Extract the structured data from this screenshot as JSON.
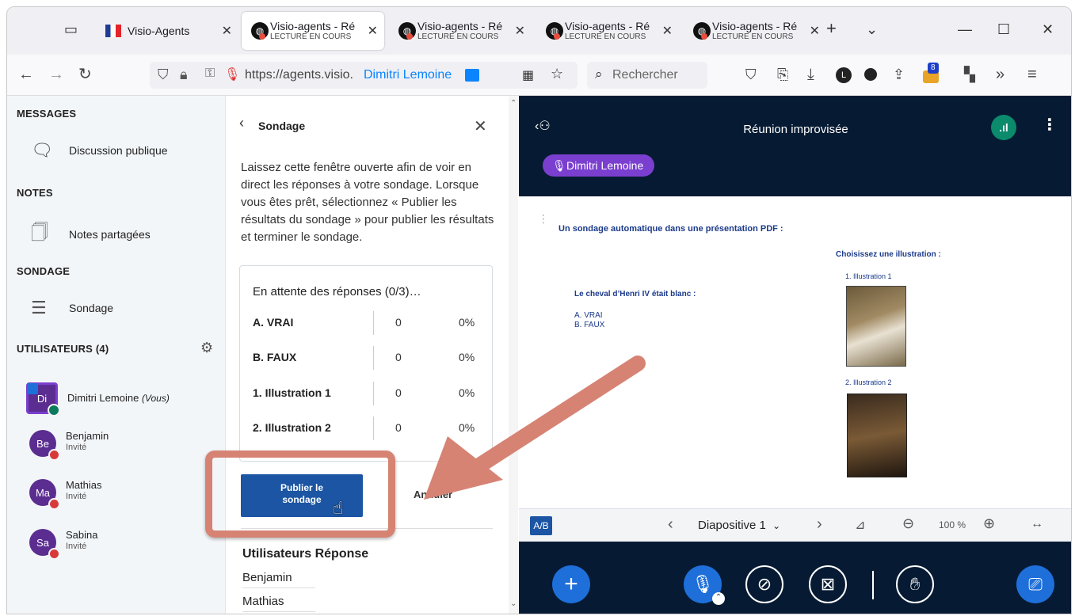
{
  "browser": {
    "tabs": [
      {
        "title": "Visio-Agents",
        "subtitle": ""
      },
      {
        "title": "Visio-agents - Ré",
        "subtitle": "LECTURE EN COURS"
      },
      {
        "title": "Visio-agents - Ré",
        "subtitle": "LECTURE EN COURS"
      },
      {
        "title": "Visio-agents - Ré",
        "subtitle": "LECTURE EN COURS"
      },
      {
        "title": "Visio-agents - Ré",
        "subtitle": "LECTURE EN COURS"
      }
    ],
    "url": "https://agents.visio.",
    "url_user": "Dimitri Lemoine",
    "search_placeholder": "Rechercher",
    "ext_badge": "8"
  },
  "sidebar": {
    "messages_heading": "MESSAGES",
    "public_chat": "Discussion publique",
    "notes_heading": "NOTES",
    "shared_notes": "Notes partagées",
    "poll_heading": "SONDAGE",
    "poll_item": "Sondage",
    "users_heading": "UTILISATEURS (4)",
    "users": [
      {
        "initials": "Di",
        "name": "Dimitri Lemoine",
        "suffix": "(Vous)",
        "role": "",
        "color": "#5b2d90"
      },
      {
        "initials": "Be",
        "name": "Benjamin",
        "suffix": "",
        "role": "Invité",
        "color": "#5b2d90"
      },
      {
        "initials": "Ma",
        "name": "Mathias",
        "suffix": "",
        "role": "Invité",
        "color": "#5b2d90"
      },
      {
        "initials": "Sa",
        "name": "Sabina",
        "suffix": "",
        "role": "Invité",
        "color": "#5b2d90"
      }
    ]
  },
  "poll_panel": {
    "title": "Sondage",
    "description": "Laissez cette fenêtre ouverte afin de voir en direct les réponses à votre sondage. Lorsque vous êtes prêt, sélectionnez « Publier les résultats du sondage » pour publier les résultats et terminer le sondage.",
    "waiting": "En attente des réponses (0/3)…",
    "rows": [
      {
        "label": "A. VRAI",
        "count": "0",
        "percent": "0%"
      },
      {
        "label": "B. FAUX",
        "count": "0",
        "percent": "0%"
      },
      {
        "label": "1. Illustration 1",
        "count": "0",
        "percent": "0%"
      },
      {
        "label": "2. Illustration 2",
        "count": "0",
        "percent": "0%"
      }
    ],
    "publish_label": "Publier le sondage",
    "cancel_label": "Annuler",
    "responses_header_users": "Utilisateurs",
    "responses_header_answer": "Réponse",
    "responders": [
      "Benjamin",
      "Mathias"
    ]
  },
  "meeting": {
    "title": "Réunion improvisée",
    "presenter": "Dimitri Lemoine",
    "slide": {
      "heading": "Un sondage automatique dans une présentation PDF :",
      "question": "Le cheval d’Henri IV était blanc :",
      "options": [
        "A. VRAI",
        "B. FAUX"
      ],
      "illus_heading": "Choisissez une illustration :",
      "illus1": "1.   Illustration 1",
      "illus2": "2.   Illustration 2"
    },
    "toolbar": {
      "ab": "A/B",
      "slide_label": "Diapositive 1",
      "zoom": "100 %"
    }
  },
  "colors": {
    "meeting_bg": "#061b33",
    "accent_blue": "#1b55a3",
    "presenter_purple": "#7a3fcf",
    "highlight": "#d68374"
  }
}
